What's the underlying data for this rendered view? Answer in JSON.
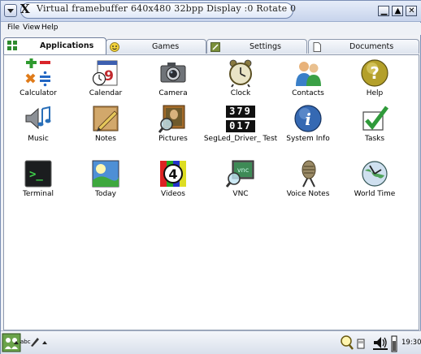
{
  "titlebar": {
    "title": "Virtual framebuffer 640x480 32bpp Display :0 Rotate 0",
    "x_logo": "X"
  },
  "menubar": {
    "file": "File",
    "view": "View",
    "help": "Help"
  },
  "tabs": [
    {
      "label": "Applications",
      "icon": "grid-icon",
      "active": true
    },
    {
      "label": "Games",
      "icon": "smiley-icon",
      "active": false
    },
    {
      "label": "Settings",
      "icon": "settings-icon",
      "active": false
    },
    {
      "label": "Documents",
      "icon": "document-icon",
      "active": false
    }
  ],
  "apps": [
    {
      "label": "Calculator",
      "icon": "calculator-icon"
    },
    {
      "label": "Calendar",
      "icon": "calendar-icon",
      "calendar_day": "9"
    },
    {
      "label": "Camera",
      "icon": "camera-icon"
    },
    {
      "label": "Clock",
      "icon": "alarm-clock-icon"
    },
    {
      "label": "Contacts",
      "icon": "contacts-icon"
    },
    {
      "label": "Help",
      "icon": "help-icon",
      "glyph": "?"
    },
    {
      "label": "Music",
      "icon": "music-icon"
    },
    {
      "label": "Notes",
      "icon": "notes-icon"
    },
    {
      "label": "Pictures",
      "icon": "pictures-icon"
    },
    {
      "label": "SegLed_Driver_ Test",
      "icon": "segled-icon",
      "digits_top": "379",
      "digits_bottom": "017"
    },
    {
      "label": "System Info",
      "icon": "system-info-icon",
      "glyph": "i"
    },
    {
      "label": "Tasks",
      "icon": "tasks-icon"
    },
    {
      "label": "Terminal",
      "icon": "terminal-icon",
      "glyph": ">_"
    },
    {
      "label": "Today",
      "icon": "today-icon"
    },
    {
      "label": "Videos",
      "icon": "videos-icon",
      "glyph": "4"
    },
    {
      "label": "VNC",
      "icon": "vnc-icon",
      "glyph": "vnc"
    },
    {
      "label": "Voice Notes",
      "icon": "voice-notes-icon"
    },
    {
      "label": "World Time",
      "icon": "world-time-icon"
    }
  ],
  "taskbar": {
    "input_method": "abc",
    "clock": "19:30"
  },
  "colors": {
    "titlebar": "#c7d4ec",
    "window_border": "#7b8fb5",
    "content_bg": "#ffffff"
  }
}
